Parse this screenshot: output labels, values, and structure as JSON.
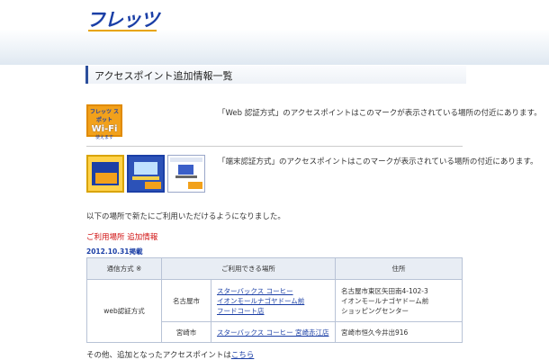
{
  "header": {
    "logo_text": "フレッツ"
  },
  "page_title": "アクセスポイント追加情報一覧",
  "web_auth_text": "「Web 認証方式」のアクセスポイントはこのマークが表示されている場所の付近にあります。",
  "terminal_auth_text": "「端末認証方式」のアクセスポイントはこのマークが表示されている場所の付近にあります。",
  "icons": {
    "wifi_line1": "フレッツ スポット",
    "wifi_line2": "Wi-Fi",
    "wifi_line3": "使えます"
  },
  "intro_text": "以下の場所で新たにご利用いただけるようになりました。",
  "section_label": "ご利用場所 追加情報",
  "date_label": "2012.10.31掲載",
  "table": {
    "headers": [
      "通信方式 ※",
      "ご利用できる場所",
      "住所"
    ],
    "method": "web認証方式",
    "rows": [
      {
        "city": "名古屋市",
        "places": [
          "スターバックス コーヒー",
          "イオンモールナゴヤドーム前",
          "フードコート店"
        ],
        "address": [
          "名古屋市東区矢田南4-102-3",
          "イオンモールナゴヤドーム前",
          "ショッピングセンター"
        ]
      },
      {
        "city": "宮崎市",
        "places": [
          "スターバックス コーヒー 宮崎赤江店"
        ],
        "address": [
          "宮崎市恒久今井出916"
        ]
      }
    ]
  },
  "footer": {
    "prefix": "その他、追加となったアクセスポイントは",
    "link": "こちら"
  },
  "colors": {
    "brand": "#1b3fa6",
    "accent": "#f2a11b",
    "alert": "#d01010"
  }
}
